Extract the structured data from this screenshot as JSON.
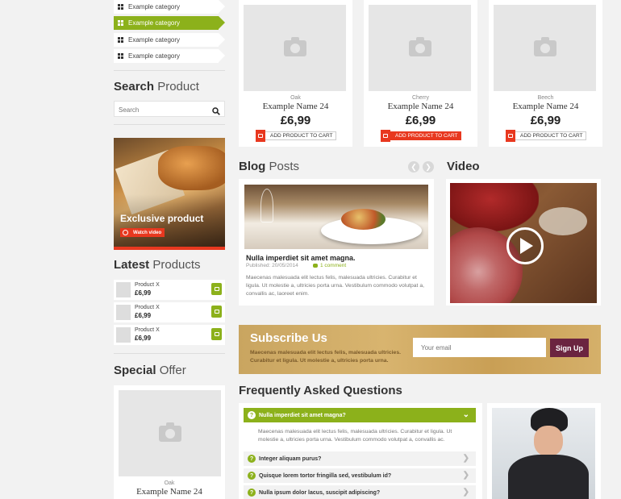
{
  "sidebar": {
    "categories": [
      {
        "label": "Example category"
      },
      {
        "label": "Example category"
      },
      {
        "label": "Example category"
      },
      {
        "label": "Example category"
      }
    ],
    "search": {
      "title_bold": "Search",
      "title_light": "Product",
      "placeholder": "Search"
    },
    "banner": {
      "title": "Exclusive product",
      "button": "Watch video"
    },
    "latest": {
      "title_bold": "Latest",
      "title_light": "Products",
      "items": [
        {
          "name": "Product X",
          "price": "£6,99"
        },
        {
          "name": "Product X",
          "price": "£6,99"
        },
        {
          "name": "Product X",
          "price": "£6,99"
        }
      ]
    },
    "special": {
      "title_bold": "Special",
      "title_light": "Offer",
      "type": "Oak",
      "name": "Example Name 24"
    }
  },
  "products": [
    {
      "type": "Oak",
      "name": "Example Name 24",
      "price": "£6,99",
      "button": "ADD PRODUCT TO CART",
      "highlight": false
    },
    {
      "type": "Cherry",
      "name": "Example Name 24",
      "price": "£6,99",
      "button": "ADD PRODUCT TO CART",
      "highlight": true
    },
    {
      "type": "Beech",
      "name": "Example Name 24",
      "price": "£6,99",
      "button": "ADD PRODUCT TO CART",
      "highlight": false
    }
  ],
  "blog": {
    "title_bold": "Blog",
    "title_light": "Posts",
    "post": {
      "title": "Nulla imperdiet sit amet magna.",
      "published": "Published: 20/05/2014",
      "comments": "1 comment",
      "excerpt": "Maecenas malesuada elit lectus felis, malesuada ultricies. Curabitur et ligula. Ut molestie a, ultricies porta urna. Vestibulum commodo volutpat a, convallis ac, laoreet enim."
    }
  },
  "video": {
    "title": "Video"
  },
  "subscribe": {
    "title": "Subscribe Us",
    "text": "Maecenas malesuada elit lectus felis, malesuada ultricies. Curabitur et ligula. Ut molestie a, ultricies porta urna.",
    "placeholder": "Your email",
    "button": "Sign Up"
  },
  "faq": {
    "title": "Frequently Asked Questions",
    "items": [
      {
        "q": "Nulla imperdiet sit amet magna?",
        "a": "Maecenas malesuada elit lectus felis, malesuada ultricies. Curabitur et ligula. Ut molestie a, ultricies porta urna. Vestibulum commodo volutpat a, convallis ac."
      },
      {
        "q": "Integer aliquam purus?"
      },
      {
        "q": "Quisque lorem tortor fringilla sed, vestibulum id?"
      },
      {
        "q": "Nulla ipsum dolor lacus, suscipit adipiscing?"
      }
    ]
  },
  "colors": {
    "accent": "#8cb11b",
    "cta": "#e8381f",
    "signup": "#6b2440"
  },
  "icons": [
    "grid-icon",
    "search-icon",
    "camera-icon",
    "cart-icon",
    "play-icon",
    "question-icon",
    "chevron-icon",
    "comment-icon"
  ]
}
